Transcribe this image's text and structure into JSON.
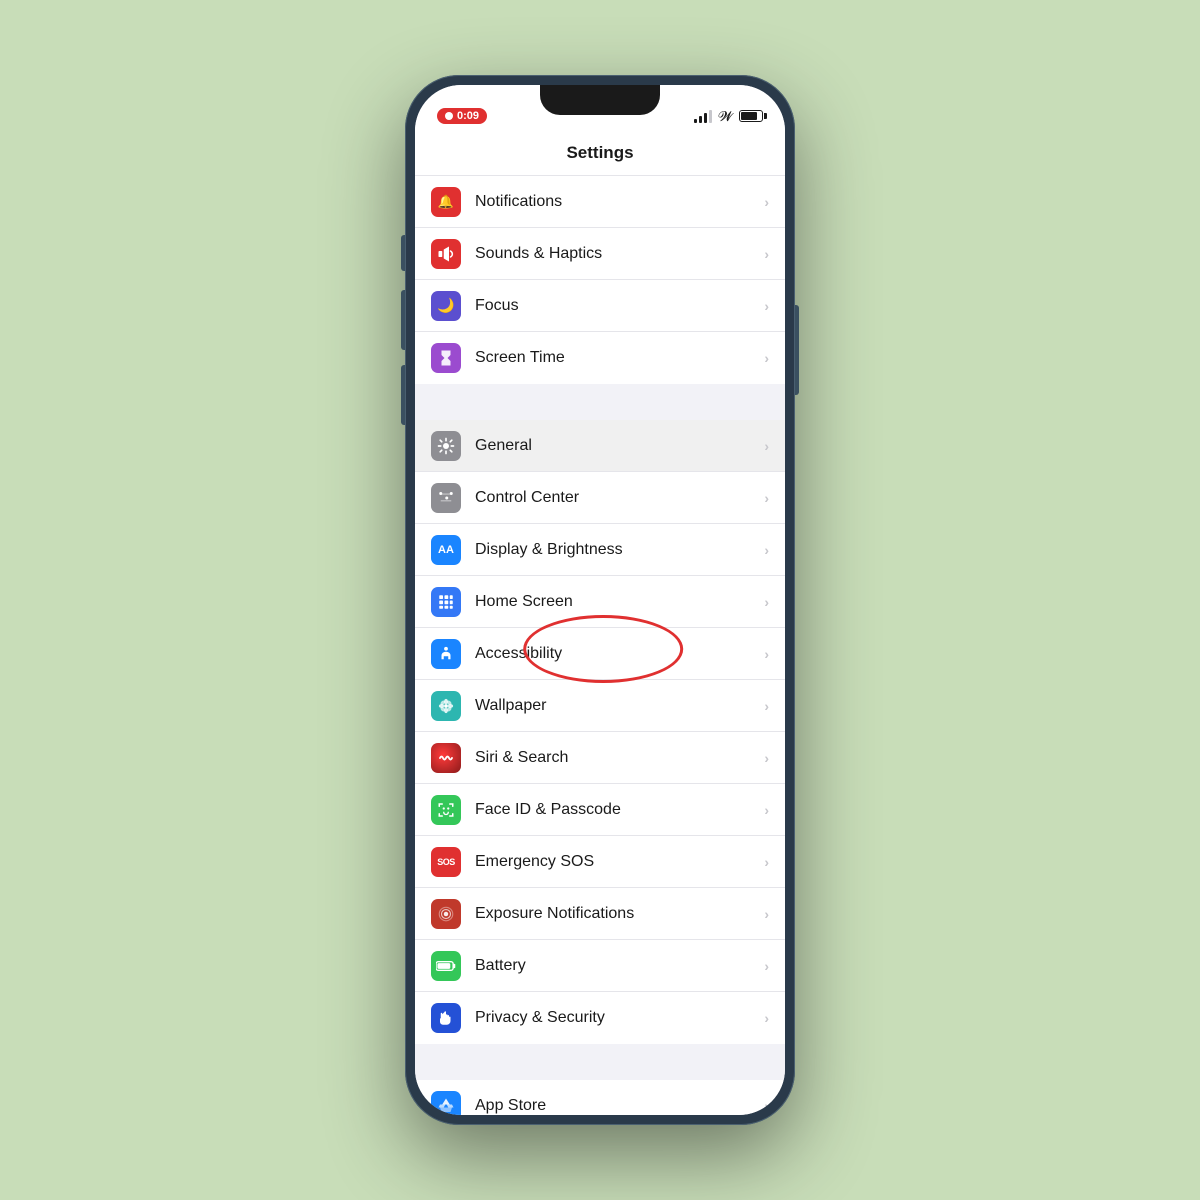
{
  "phone": {
    "title": "Settings",
    "status": {
      "recording_time": "0:09",
      "battery_level": 80
    },
    "settings_items": [
      {
        "id": "notifications",
        "label": "Notifications",
        "icon_color": "icon-red",
        "icon_symbol": "🔔",
        "icon_text": "bell"
      },
      {
        "id": "sounds-haptics",
        "label": "Sounds & Haptics",
        "icon_color": "icon-red-sound",
        "icon_symbol": "🔊",
        "icon_text": "speaker"
      },
      {
        "id": "focus",
        "label": "Focus",
        "icon_color": "icon-purple",
        "icon_symbol": "🌙",
        "icon_text": "moon"
      },
      {
        "id": "screen-time",
        "label": "Screen Time",
        "icon_color": "icon-purple-screen",
        "icon_symbol": "⏳",
        "icon_text": "hourglass"
      }
    ],
    "settings_items2": [
      {
        "id": "general",
        "label": "General",
        "icon_color": "icon-gray",
        "icon_symbol": "⚙️",
        "icon_text": "gear",
        "highlighted": true
      },
      {
        "id": "control-center",
        "label": "Control Center",
        "icon_color": "icon-gray2",
        "icon_symbol": "⊞",
        "icon_text": "grid"
      },
      {
        "id": "display-brightness",
        "label": "Display & Brightness",
        "icon_color": "icon-blue",
        "icon_symbol": "AA",
        "icon_text": "display"
      },
      {
        "id": "home-screen",
        "label": "Home Screen",
        "icon_color": "icon-blue-home",
        "icon_symbol": "⠿",
        "icon_text": "home-grid"
      },
      {
        "id": "accessibility",
        "label": "Accessibility",
        "icon_color": "icon-blue-access",
        "icon_symbol": "♿",
        "icon_text": "accessibility"
      },
      {
        "id": "wallpaper",
        "label": "Wallpaper",
        "icon_color": "icon-teal",
        "icon_symbol": "✿",
        "icon_text": "flower"
      },
      {
        "id": "siri-search",
        "label": "Siri & Search",
        "icon_color": "icon-dark-red",
        "icon_symbol": "◉",
        "icon_text": "siri"
      },
      {
        "id": "face-id",
        "label": "Face ID & Passcode",
        "icon_color": "icon-green",
        "icon_symbol": "🙂",
        "icon_text": "face-id"
      },
      {
        "id": "emergency-sos",
        "label": "Emergency SOS",
        "icon_color": "icon-sos",
        "icon_symbol": "SOS",
        "icon_text": "sos"
      },
      {
        "id": "exposure-notifications",
        "label": "Exposure Notifications",
        "icon_color": "icon-dark-red",
        "icon_symbol": "✳",
        "icon_text": "exposure"
      },
      {
        "id": "battery",
        "label": "Battery",
        "icon_color": "icon-green2",
        "icon_symbol": "▬",
        "icon_text": "battery"
      },
      {
        "id": "privacy-security",
        "label": "Privacy & Security",
        "icon_color": "icon-blue-privacy",
        "icon_symbol": "✋",
        "icon_text": "hand"
      }
    ],
    "settings_items3": [
      {
        "id": "app-store",
        "label": "App Store",
        "icon_color": "icon-blue",
        "icon_symbol": "A",
        "icon_text": "app-store"
      }
    ]
  }
}
